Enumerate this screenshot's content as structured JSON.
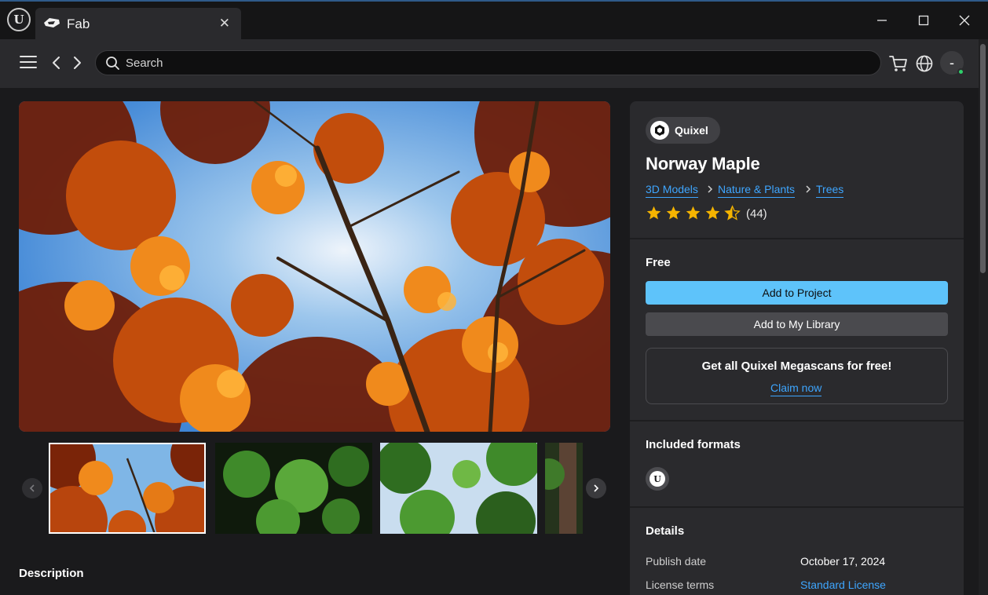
{
  "titlebar": {
    "tab_title": "Fab",
    "tab_close_glyph": "✕",
    "app_icon": "unreal-engine-logo-icon",
    "tab_icon": "fab-logo-icon",
    "window_controls": [
      "minimize-icon",
      "maximize-icon",
      "close-icon"
    ]
  },
  "navbar": {
    "search_placeholder": "Search",
    "search_value": "",
    "icons": [
      "hamburger-menu-icon",
      "back-arrow-icon",
      "forward-arrow-icon",
      "search-icon",
      "cart-icon",
      "globe-icon"
    ],
    "avatar_text": "-",
    "online_status_color": "#2fd06b"
  },
  "gallery": {
    "images": [
      {
        "subject": "Autumn maple canopy from below",
        "selected": true
      },
      {
        "subject": "Green maple leaves close-up",
        "selected": false
      },
      {
        "subject": "Green canopy with sky",
        "selected": false
      },
      {
        "subject": "Tree trunk in forest",
        "selected": false
      }
    ],
    "prev_icon": "chevron-left-icon",
    "next_icon": "chevron-right-icon"
  },
  "description": {
    "heading": "Description"
  },
  "product": {
    "publisher": "Quixel",
    "title": "Norway Maple",
    "breadcrumbs": [
      "3D Models",
      "Nature & Plants",
      "Trees"
    ],
    "rating": 4.5,
    "rating_count": "(44)",
    "price": "Free",
    "primary_button": "Add to Project",
    "secondary_button": "Add to My Library",
    "promo_text": "Get all Quixel Megascans for free!",
    "promo_link": "Claim now",
    "formats_heading": "Included formats",
    "formats": [
      "unreal-engine-format-icon"
    ],
    "details_heading": "Details",
    "details": [
      {
        "label": "Publish date",
        "value": "October 17, 2024",
        "is_link": false
      },
      {
        "label": "License terms",
        "value": "Standard License",
        "is_link": true
      }
    ]
  },
  "colors": {
    "accent_blue": "#5ec3fa",
    "link_blue": "#3ea6ff",
    "star_gold": "#f5b400",
    "panel_bg": "#2a2a2d",
    "page_bg": "#1a1a1c"
  }
}
